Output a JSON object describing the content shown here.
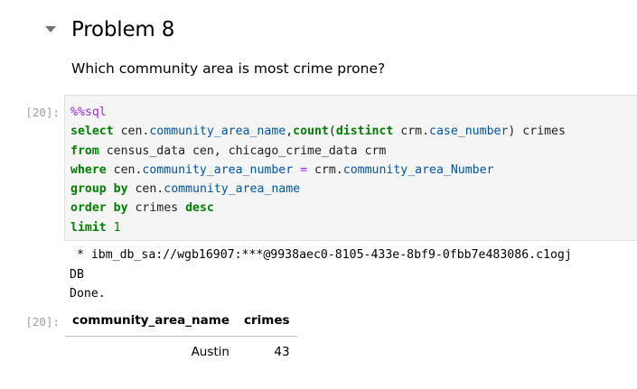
{
  "markdown": {
    "heading": "Problem 8",
    "question": "Which community area is most crime prone?"
  },
  "code_cell": {
    "prompt": "[20]:",
    "lines": {
      "l1": {
        "magic": "%%sql"
      },
      "l2": {
        "kw1": "select",
        "t1": " cen.",
        "a1": "community_area_name",
        "t2": ",",
        "fn": "count",
        "t3": "(",
        "kw2": "distinct",
        "t4": " crm.",
        "a2": "case_number",
        "t5": ") crimes"
      },
      "l3": {
        "kw1": "from",
        "t1": " census_data cen, chicago_crime_data crm"
      },
      "l4": {
        "kw1": "where",
        "t1": " cen.",
        "a1": "community_area_number",
        "t2": " ",
        "op": "=",
        "t3": " crm.",
        "a2": "community_area_Number"
      },
      "l5": {
        "kw1": "group",
        "t1": " ",
        "kw2": "by",
        "t2": " cen.",
        "a1": "community_area_name"
      },
      "l6": {
        "kw1": "order",
        "t1": " ",
        "kw2": "by",
        "t2": " crimes ",
        "kw3": "desc"
      },
      "l7": {
        "kw1": "limit",
        "t1": " ",
        "num": "1"
      }
    }
  },
  "stdout": {
    "line1": " * ibm_db_sa://wgb16907:***@9938aec0-8105-433e-8bf9-0fbb7e483086.c1ogj",
    "line2": "DB",
    "line3": "Done."
  },
  "result": {
    "prompt": "[20]:",
    "columns": [
      "community_area_name",
      "crimes"
    ],
    "rows": [
      [
        "Austin",
        "43"
      ]
    ]
  }
}
